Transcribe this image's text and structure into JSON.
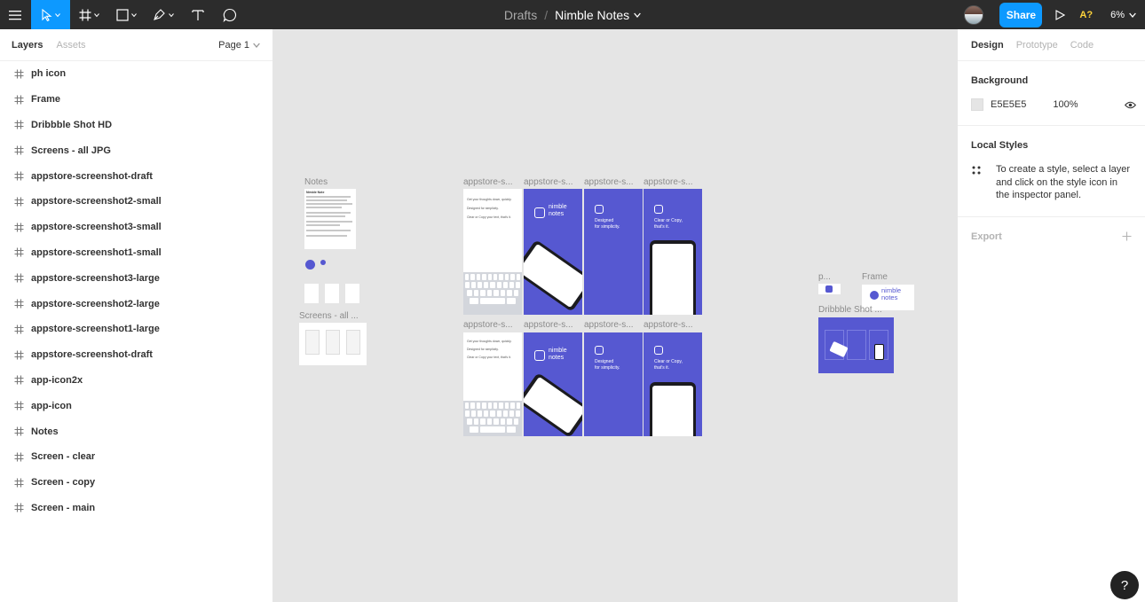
{
  "toolbar": {
    "breadcrumb": "Drafts",
    "separator": "/",
    "file_name": "Nimble Notes",
    "share_label": "Share",
    "accessibility_label": "A?",
    "zoom": "6%"
  },
  "left_panel": {
    "tabs": [
      "Layers",
      "Assets"
    ],
    "page": "Page 1",
    "layers": [
      "ph icon",
      "Frame",
      "Dribbble Shot HD",
      "Screens - all JPG",
      "appstore-screenshot-draft",
      "appstore-screenshot2-small",
      "appstore-screenshot3-small",
      "appstore-screenshot1-small",
      "appstore-screenshot3-large",
      "appstore-screenshot2-large",
      "appstore-screenshot1-large",
      "appstore-screenshot-draft",
      "app-icon2x",
      "app-icon",
      "Notes",
      "Screen - clear",
      "Screen - copy",
      "Screen - main"
    ]
  },
  "canvas": {
    "labels": {
      "notes": "Notes",
      "screens_all": "Screens - all ...",
      "appstore": "appstore-s...",
      "p": "p...",
      "frame": "Frame",
      "dribbble": "Dribbble Shot ..."
    },
    "note_heading": "Nimble Note",
    "logo_line1": "nimble",
    "logo_line2": "notes",
    "designed": "Designed",
    "for_simplicity": "for simplicity.",
    "clear_or_copy": "Clear or Copy,",
    "thats_it": "that's it.",
    "bullet1": "Get your thoughts down, quickly.",
    "bullet2": "Designed for simplicity.",
    "bullet3": "Clear or Copy your text, that's it."
  },
  "right_panel": {
    "tabs": [
      "Design",
      "Prototype",
      "Code"
    ],
    "background_title": "Background",
    "bg_hex": "E5E5E5",
    "bg_opacity": "100%",
    "local_styles_title": "Local Styles",
    "local_styles_hint": "To create a style, select a layer and click on the style icon in the inspector panel.",
    "export_title": "Export"
  },
  "help_label": "?",
  "colors": {
    "toolbar": "#2c2c2c",
    "accent": "#0d99ff",
    "brand_blue": "#5658d1",
    "canvas": "#e5e5e5"
  }
}
